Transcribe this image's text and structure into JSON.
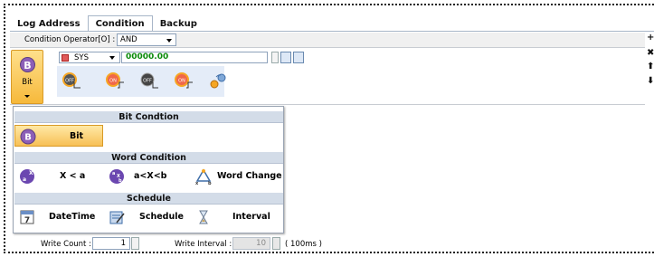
{
  "tabs": [
    {
      "label": "Log Address",
      "active": false
    },
    {
      "label": "Condition",
      "active": true
    },
    {
      "label": "Backup",
      "active": false
    }
  ],
  "operator": {
    "label": "Condition Operator[O] :",
    "value": "AND"
  },
  "trigger_button": {
    "label": "Bit",
    "icon": "bit-circle-icon"
  },
  "device": {
    "type": "SYS",
    "address": "00000.00"
  },
  "condition_icons": [
    "off-falling-icon",
    "on-rising-icon",
    "off-level-icon",
    "on-level-icon",
    "change-icon"
  ],
  "side_tools": [
    "add-icon",
    "delete-icon",
    "move-up-icon",
    "move-down-icon"
  ],
  "popup": {
    "sections": [
      {
        "title": "Bit Condtion",
        "items": [
          {
            "label": "Bit",
            "icon": "bit-circle-icon",
            "selected": true
          }
        ]
      },
      {
        "title": "Word Condition",
        "items": [
          {
            "label": "X < a",
            "icon": "x-less-a-icon"
          },
          {
            "label": "a<X<b",
            "icon": "range-icon"
          },
          {
            "label": "Word Change",
            "icon": "word-change-icon"
          }
        ]
      },
      {
        "title": "Schedule",
        "items": [
          {
            "label": "DateTime",
            "icon": "calendar-icon"
          },
          {
            "label": "Schedule",
            "icon": "schedule-icon"
          },
          {
            "label": "Interval",
            "icon": "hourglass-icon"
          }
        ]
      }
    ],
    "grip": "...."
  },
  "write_count": {
    "label": "Write Count :",
    "value": "1"
  },
  "write_interval": {
    "label": "Write Interval :",
    "value": "10",
    "unit": "( 100ms )"
  },
  "colors": {
    "accent": "#f6b93b",
    "header": "#d3dce8",
    "address_green": "#0a8a0a"
  }
}
